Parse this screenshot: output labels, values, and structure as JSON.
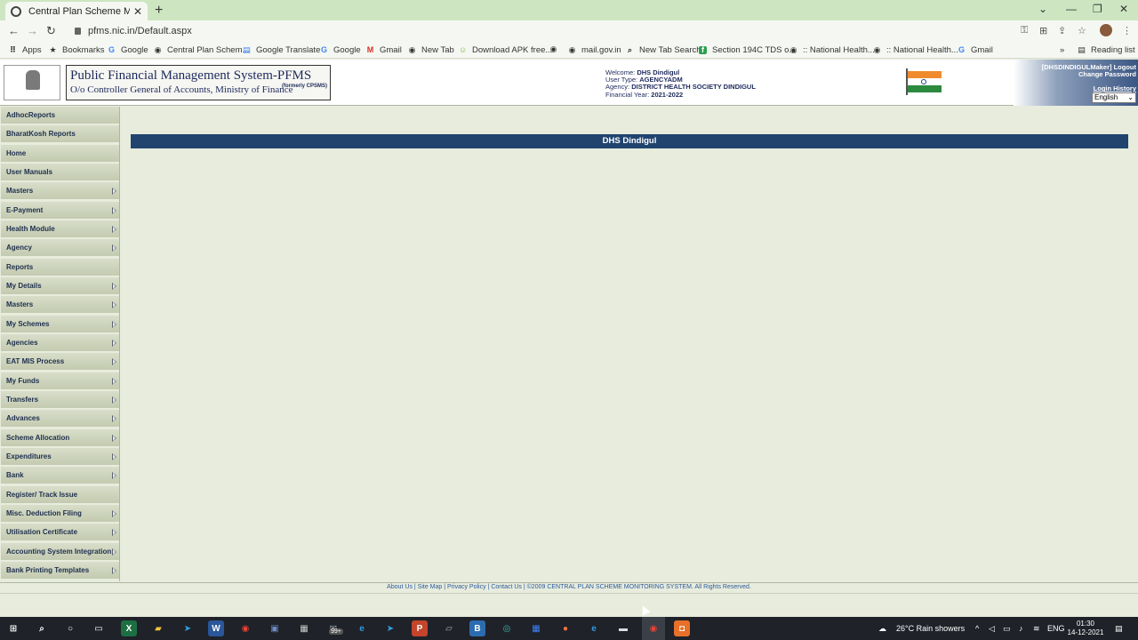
{
  "browser": {
    "tab_title": "Central Plan Scheme Monitoring",
    "url": "pfms.nic.in/Default.aspx",
    "bookmarks": [
      {
        "label": "Apps",
        "icon": "apps-grid-icon"
      },
      {
        "label": "Bookmarks",
        "icon": "star-icon"
      },
      {
        "label": "Google",
        "icon": "google-icon"
      },
      {
        "label": "Central Plan Schem...",
        "icon": "globe-icon"
      },
      {
        "label": "Google Translate",
        "icon": "translate-icon"
      },
      {
        "label": "Google",
        "icon": "google-icon"
      },
      {
        "label": "Gmail",
        "icon": "gmail-icon"
      },
      {
        "label": "New Tab",
        "icon": "globe-icon"
      },
      {
        "label": "Download APK free...",
        "icon": "android-icon"
      },
      {
        "label": "",
        "icon": "globe-icon"
      },
      {
        "label": "mail.gov.in",
        "icon": "globe-icon"
      },
      {
        "label": "New Tab Search",
        "icon": "search-icon"
      },
      {
        "label": "Section 194C TDS o...",
        "icon": "bookmark-green-icon"
      },
      {
        "label": ":: National Health...",
        "icon": "globe-icon"
      },
      {
        "label": ":: National Health...",
        "icon": "globe-icon"
      },
      {
        "label": "Gmail",
        "icon": "google-icon"
      }
    ],
    "reading_list": "Reading list"
  },
  "header": {
    "title_main": "Public Financial Management System-PFMS",
    "title_sub": "O/o Controller General of Accounts, Ministry of Finance",
    "formerly": "(formerly CPSMS)",
    "welcome_label": "Welcome:",
    "welcome_value": "DHS Dindigul",
    "user_type_label": "User Type:",
    "user_type_value": "AGENCYADM",
    "agency_label": "Agency:",
    "agency_value": "DISTRICT HEALTH SOCIETY DINDIGUL",
    "fy_label": "Financial Year:",
    "fy_value": "2021-2022",
    "user_logout": "[DHSDINDIGULMaker] Logout",
    "change_password": "Change Password",
    "login_history": "Login History",
    "language": "English"
  },
  "sidebar": {
    "items": [
      {
        "label": "AdhocReports",
        "submenu": false
      },
      {
        "label": "BharatKosh Reports",
        "submenu": false
      },
      {
        "label": "Home",
        "submenu": false
      },
      {
        "label": "User Manuals",
        "submenu": false
      },
      {
        "label": "Masters",
        "submenu": true
      },
      {
        "label": "E-Payment",
        "submenu": true
      },
      {
        "label": "Health Module",
        "submenu": true
      },
      {
        "label": "Agency",
        "submenu": true
      },
      {
        "label": "Reports",
        "submenu": false
      },
      {
        "label": "My Details",
        "submenu": true
      },
      {
        "label": "Masters",
        "submenu": true
      },
      {
        "label": "My Schemes",
        "submenu": true
      },
      {
        "label": "Agencies",
        "submenu": true
      },
      {
        "label": "EAT MIS Process",
        "submenu": true
      },
      {
        "label": "My Funds",
        "submenu": true
      },
      {
        "label": "Transfers",
        "submenu": true
      },
      {
        "label": "Advances",
        "submenu": true
      },
      {
        "label": "Scheme Allocation",
        "submenu": true
      },
      {
        "label": "Expenditures",
        "submenu": true
      },
      {
        "label": "Bank",
        "submenu": true
      },
      {
        "label": "Register/ Track Issue",
        "submenu": false
      },
      {
        "label": "Misc. Deduction Filing",
        "submenu": true
      },
      {
        "label": "Utilisation Certificate",
        "submenu": true
      },
      {
        "label": "Accounting System Integration",
        "submenu": true
      },
      {
        "label": "Bank Printing Templates",
        "submenu": true
      }
    ]
  },
  "main": {
    "header_title": "DHS Dindigul"
  },
  "footer": {
    "about": "About Us",
    "sitemap": "Site Map",
    "privacy": "Privacy Policy",
    "contact": "Contact Us",
    "copyright": "| ©2009 CENTRAL PLAN SCHEME MONITORING SYSTEM. All Rights Reserved."
  },
  "taskbar": {
    "badge": "99+",
    "weather": "26°C  Rain showers",
    "lang": "ENG",
    "time": "01:30",
    "date": "14-12-2021"
  }
}
